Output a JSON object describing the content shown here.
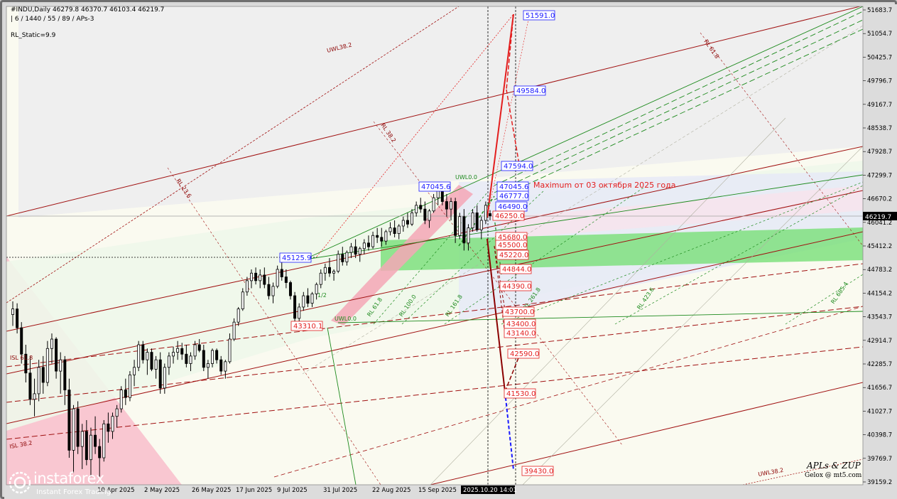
{
  "header": {
    "symbol_line": "#INDU,Daily  46279.8 46370.7 46103.4 46219.7",
    "params_line": "| 6 / 1440 / 55 / 89 / APs-3",
    "static_line": "RL_Static=9.9"
  },
  "branding": {
    "logo_name": "instaforex",
    "logo_tagline": "Instant Forex Trading",
    "credit_title": "APLs & ZUP",
    "credit_site": "Gelox @ mt5.com"
  },
  "colors": {
    "blue": "#1a1aff",
    "red": "#e31e1e",
    "dark_red": "#8b0000",
    "green": "#1d8a1d",
    "band_green": "#7fe07f",
    "pink": "#f5a7b6",
    "candle": "#000000"
  },
  "chart_data": {
    "type": "candlestick",
    "title": "#INDU,Daily",
    "ylim": [
      39159.2,
      51683.7
    ],
    "y_ticks": [
      "51683.7",
      "51054.7",
      "50425.7",
      "49796.7",
      "49167.7",
      "48538.7",
      "47928.7",
      "47299.7",
      "46670.2",
      "46041.2",
      "45412.2",
      "44783.2",
      "44154.2",
      "43543.7",
      "42914.7",
      "42285.7",
      "41656.7",
      "41027.7",
      "40398.7",
      "39769.7",
      "39159.2"
    ],
    "x_ticks": [
      "10 Apr 2025",
      "2 May 2025",
      "26 May 2025",
      "17 Jun 2025",
      "9 Jul 2025",
      "31 Jul 2025",
      "22 Aug 2025",
      "15 Sep 2025",
      "2025.10.20 14:01"
    ],
    "current_price": "46219.7",
    "annotation": "Maximum от 03 октября 2025 года",
    "blue_levels": [
      "51591.0",
      "49584.0",
      "47594.0",
      "47045.6",
      "46777.0",
      "46490.0",
      "47045.6",
      "45125.9"
    ],
    "red_levels": [
      "46250.0",
      "45680.0",
      "45500.0",
      "45220.0",
      "44844.0",
      "44390.0",
      "43700.0",
      "43400.0",
      "43140.0",
      "42590.0",
      "41530.0",
      "43310.1"
    ],
    "bottom_level": "39430.0",
    "line_labels": [
      "UWL38.2",
      "UWL0.0",
      "UWL0.0",
      "RL 23.6",
      "RL 38.2",
      "RL 61.8",
      "RL 61.8",
      "RL 100.0",
      "RL 161.8",
      "RL 423.6",
      "RL 685.4",
      "RL 261.8",
      "ISL 61.8",
      "ISL 38.2",
      "1/2"
    ],
    "series": [
      {
        "values": [
          [
            43600,
            43950,
            43300,
            43750
          ],
          [
            43750,
            43900,
            43100,
            43250
          ],
          [
            43250,
            43400,
            42300,
            42550
          ],
          [
            42550,
            42800,
            41800,
            42050
          ],
          [
            42050,
            42500,
            41200,
            41350
          ],
          [
            41350,
            41900,
            40900,
            41500
          ],
          [
            41500,
            42400,
            41300,
            42200
          ],
          [
            42200,
            42500,
            41500,
            41800
          ],
          [
            41800,
            42900,
            41700,
            42700
          ],
          [
            42700,
            43100,
            42300,
            42950
          ],
          [
            42950,
            43000,
            41900,
            42100
          ],
          [
            42100,
            42600,
            41500,
            42400
          ],
          [
            42400,
            42500,
            41200,
            41600
          ],
          [
            41600,
            41900,
            39800,
            40000
          ],
          [
            40000,
            41200,
            39400,
            41100
          ],
          [
            41100,
            41300,
            39900,
            40100
          ],
          [
            40100,
            40700,
            39500,
            40500
          ],
          [
            40500,
            40800,
            39600,
            39750
          ],
          [
            39750,
            40600,
            39300,
            40400
          ],
          [
            40400,
            40900,
            39900,
            40100
          ],
          [
            40100,
            40300,
            39300,
            39800
          ],
          [
            39800,
            40800,
            39700,
            40700
          ],
          [
            40700,
            41000,
            40200,
            40500
          ],
          [
            40500,
            41000,
            40300,
            40900
          ],
          [
            40900,
            41200,
            40600,
            41100
          ],
          [
            41100,
            41700,
            41000,
            41600
          ],
          [
            41600,
            41900,
            41200,
            41400
          ],
          [
            41400,
            42100,
            41300,
            42000
          ],
          [
            42000,
            42400,
            41700,
            42200
          ],
          [
            42200,
            42900,
            42100,
            42800
          ],
          [
            42800,
            42900,
            42300,
            42400
          ],
          [
            42400,
            42700,
            42000,
            42600
          ],
          [
            42600,
            42700,
            42100,
            42150
          ],
          [
            42150,
            42500,
            41900,
            42400
          ],
          [
            42400,
            42600,
            41500,
            41650
          ],
          [
            41650,
            42300,
            41500,
            42200
          ],
          [
            42200,
            42600,
            42000,
            42500
          ],
          [
            42500,
            42750,
            42300,
            42600
          ],
          [
            42600,
            42900,
            42400,
            42700
          ],
          [
            42700,
            42850,
            42400,
            42550
          ],
          [
            42550,
            42800,
            42200,
            42300
          ],
          [
            42300,
            42600,
            42100,
            42500
          ],
          [
            42500,
            42900,
            42400,
            42800
          ],
          [
            42800,
            42950,
            42600,
            42650
          ],
          [
            42650,
            42800,
            42100,
            42200
          ],
          [
            42200,
            42400,
            41900,
            42300
          ],
          [
            42300,
            42700,
            42200,
            42650
          ],
          [
            42650,
            42700,
            42300,
            42400
          ],
          [
            42400,
            42500,
            42000,
            42100
          ],
          [
            42100,
            42400,
            41900,
            42350
          ],
          [
            42350,
            43100,
            42300,
            42950
          ],
          [
            42950,
            43500,
            42900,
            43400
          ],
          [
            43400,
            43800,
            43300,
            43750
          ],
          [
            43750,
            44300,
            43700,
            44200
          ],
          [
            44200,
            44600,
            44100,
            44500
          ],
          [
            44500,
            44800,
            44300,
            44700
          ],
          [
            44700,
            44850,
            44400,
            44500
          ],
          [
            44500,
            44800,
            44300,
            44650
          ],
          [
            44650,
            44850,
            44300,
            44400
          ],
          [
            44400,
            44600,
            44000,
            44100
          ],
          [
            44100,
            44450,
            43900,
            44350
          ],
          [
            44350,
            44900,
            44300,
            44800
          ],
          [
            44800,
            45000,
            44500,
            44600
          ],
          [
            44600,
            44800,
            44300,
            44450
          ],
          [
            44450,
            44500,
            44000,
            44100
          ],
          [
            44100,
            44200,
            43400,
            43500
          ],
          [
            43500,
            43900,
            43300,
            43800
          ],
          [
            43800,
            44200,
            43700,
            44100
          ],
          [
            44100,
            44300,
            43800,
            43900
          ],
          [
            43900,
            44200,
            43800,
            44150
          ],
          [
            44150,
            44450,
            44000,
            44400
          ],
          [
            44400,
            44800,
            44300,
            44700
          ],
          [
            44700,
            44950,
            44500,
            44850
          ],
          [
            44850,
            45100,
            44600,
            44700
          ],
          [
            44700,
            44800,
            44500,
            44750
          ],
          [
            44750,
            45300,
            44700,
            45200
          ],
          [
            45200,
            45400,
            44900,
            45000
          ],
          [
            45000,
            45300,
            44900,
            45250
          ],
          [
            45250,
            45500,
            45100,
            45400
          ],
          [
            45400,
            45600,
            45100,
            45200
          ],
          [
            45200,
            45400,
            45000,
            45350
          ],
          [
            45350,
            45600,
            45200,
            45500
          ],
          [
            45500,
            45700,
            45300,
            45400
          ],
          [
            45400,
            45800,
            45350,
            45700
          ],
          [
            45700,
            45900,
            45500,
            45650
          ],
          [
            45650,
            45900,
            45400,
            45550
          ],
          [
            45550,
            45850,
            45450,
            45800
          ],
          [
            45800,
            46050,
            45700,
            45900
          ],
          [
            45900,
            46100,
            45650,
            45750
          ],
          [
            45750,
            46000,
            45600,
            45950
          ],
          [
            45950,
            46200,
            45800,
            46100
          ],
          [
            46100,
            46300,
            45900,
            46000
          ],
          [
            46000,
            46400,
            45950,
            46300
          ],
          [
            46300,
            46600,
            46200,
            46500
          ],
          [
            46500,
            46700,
            46300,
            46400
          ],
          [
            46400,
            46600,
            46000,
            46100
          ],
          [
            46100,
            46400,
            45900,
            46350
          ],
          [
            46350,
            46800,
            46300,
            46700
          ],
          [
            46700,
            47045,
            46500,
            46900
          ],
          [
            46900,
            47000,
            46500,
            46600
          ],
          [
            46600,
            46800,
            46200,
            46400
          ],
          [
            46400,
            46700,
            46100,
            46600
          ],
          [
            46600,
            46700,
            45500,
            45700
          ],
          [
            45700,
            46300,
            45600,
            46200
          ],
          [
            46200,
            46400,
            45300,
            45500
          ],
          [
            45500,
            46000,
            45300,
            45900
          ],
          [
            45900,
            46400,
            45800,
            46300
          ],
          [
            46300,
            46500,
            45800,
            45850
          ],
          [
            45850,
            46200,
            45600,
            46100
          ],
          [
            46100,
            46600,
            46000,
            46500
          ],
          [
            46279.8,
            46370.7,
            46103.4,
            46219.7
          ]
        ]
      }
    ]
  }
}
